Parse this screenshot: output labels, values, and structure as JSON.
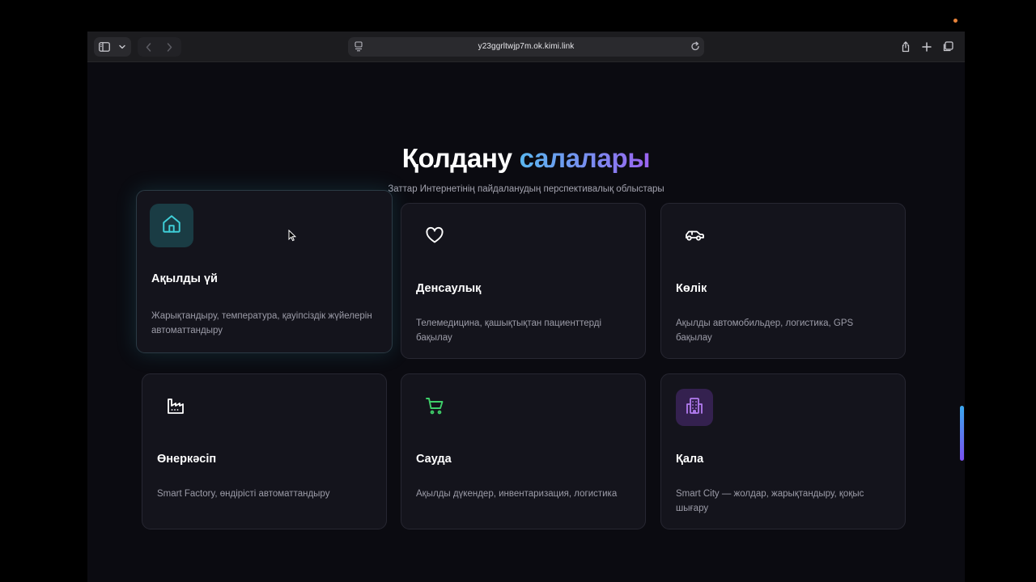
{
  "browser": {
    "url": "y23ggrltwjp7m.ok.kimi.link"
  },
  "page": {
    "title_main": "Қолдану",
    "title_accent": "салалары",
    "subtitle": "Заттар Интернетінің пайдаланудың перспективалық облыстары"
  },
  "cards": [
    {
      "title": "Ақылды үй",
      "desc": "Жарықтандыру, температура, қауіпсіздік жүйелерін автоматтандыру",
      "icon": "home-icon",
      "color": "#3fcfd8"
    },
    {
      "title": "Денсаулық",
      "desc": "Телемедицина, қашықтықтан пациенттерді бақылау",
      "icon": "heart-icon",
      "color": "#ffffff"
    },
    {
      "title": "Көлік",
      "desc": "Ақылды автомобильдер, логистика, GPS бақылау",
      "icon": "car-icon",
      "color": "#ffffff"
    },
    {
      "title": "Өнеркәсіп",
      "desc": "Smart Factory, өндірісті автоматтандыру",
      "icon": "factory-icon",
      "color": "#ffffff"
    },
    {
      "title": "Сауда",
      "desc": "Ақылды дүкендер, инвентаризация, логистика",
      "icon": "cart-icon",
      "color": "#3fd06a"
    },
    {
      "title": "Қала",
      "desc": "Smart City — жолдар, жарықтандыру, қоқыс шығару",
      "icon": "city-icon",
      "color": "#b27cf0"
    }
  ]
}
